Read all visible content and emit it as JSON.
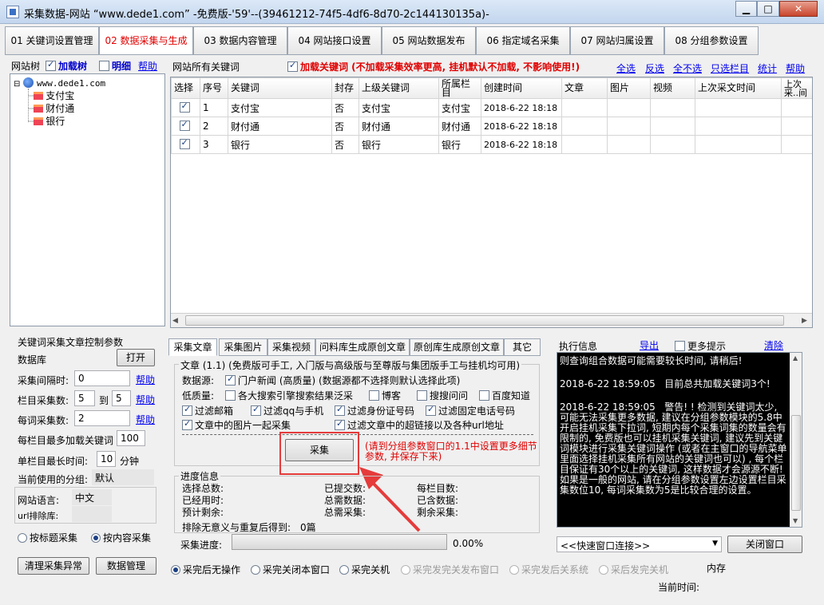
{
  "window": {
    "title": "采集数据-网站 “www.dede1.com” -免费版-'59'--(39461212-74f5-4df6-8d70-2c144130135a)-",
    "min_symbol": "▁",
    "max_symbol": "□",
    "close_symbol": "✕"
  },
  "tabs": [
    {
      "label": "01 关键词设置管理"
    },
    {
      "label": "02 数据采集与生成"
    },
    {
      "label": "03 数据内容管理"
    },
    {
      "label": "04 网站接口设置"
    },
    {
      "label": "05 网站数据发布"
    },
    {
      "label": "06 指定域名采集"
    },
    {
      "label": "07 网站归属设置"
    },
    {
      "label": "08 分组参数设置"
    }
  ],
  "tree_header": {
    "title": "网站树",
    "load_tree": "加载树",
    "detail": "明细",
    "help": "帮助"
  },
  "tree": {
    "root": "www.dede1.com",
    "children": [
      "支付宝",
      "财付通",
      "银行"
    ]
  },
  "kw_header": {
    "title": "网站所有关键词",
    "load_kw": "加载关键词 (不加载采集效率更高, 挂机默认不加载, 不影响使用!)",
    "links": [
      "全选",
      "反选",
      "全不选",
      "只选栏目",
      "统计",
      "帮助"
    ]
  },
  "table": {
    "columns": [
      "选择",
      "序号",
      "关键词",
      "封存",
      "上级关键词",
      "所属栏目",
      "创建时间",
      "文章",
      "图片",
      "视频",
      "上次采文时间",
      "上次采..间"
    ],
    "rows": [
      {
        "no": "1",
        "kw": "支付宝",
        "sealed": "否",
        "parent": "支付宝",
        "column": "支付宝",
        "time": "2018-6-22  18:18"
      },
      {
        "no": "2",
        "kw": "财付通",
        "sealed": "否",
        "parent": "财付通",
        "column": "财付通",
        "time": "2018-6-22  18:18"
      },
      {
        "no": "3",
        "kw": "银行",
        "sealed": "否",
        "parent": "银行",
        "column": "银行",
        "time": "2018-6-22  18:18"
      }
    ]
  },
  "params": {
    "title": "关键词采集文章控制参数",
    "db_label": "数据库",
    "open_btn": "打开",
    "interval_label": "采集间隔时:",
    "interval_val": "0",
    "col_count_label": "栏目采集数:",
    "col_from": "5",
    "to_label": "到",
    "col_to": "5",
    "kw_count_label": "每词采集数:",
    "kw_count": "2",
    "help": "帮助",
    "max_kw_label": "每栏目最多加载关键词",
    "max_kw": "100",
    "max_time_label": "单栏目最长时间:",
    "max_time": "10",
    "minute": "分钟",
    "group_label": "当前使用的分组:",
    "group_val": "默认",
    "lang_label": "网站语言:",
    "lang_val": "中文",
    "url_label": "url排除库:",
    "by_title": "按标题采集",
    "by_content": "按内容采集",
    "clear_btn": "清理采集异常",
    "data_btn": "数据管理"
  },
  "subtabs": [
    "采集文章",
    "采集图片",
    "采集视频",
    "问料库生成原创文章",
    "原创库生成原创文章",
    "其它"
  ],
  "article": {
    "legend": "文章 (1.1) (免费版可手工, 入门版与高级版与至尊版与集团版手工与挂机均可用)",
    "source_label": "数据源:",
    "source_opt": "门户新闻 (高质量) (数据源都不选择则默认选择此项)",
    "lowq_label": "低质量:",
    "lowq_opts": [
      "各大搜索引擎搜索结果泛采",
      "博客",
      "搜搜问问",
      "百度知道"
    ],
    "filters": [
      "过滤邮箱",
      "过滤qq与手机",
      "过滤身份证号码",
      "过滤固定电话号码"
    ],
    "img_opt": "文章中的图片一起采集",
    "url_opt": "过滤文章中的超链接以及各种url地址",
    "collect_btn": "采集",
    "note": "(请到分组参数窗口的1.1中设置更多细节参数, 并保存下来)"
  },
  "progress": {
    "legend": "进度信息",
    "labels": [
      "选择总数:",
      "已提交数:",
      "每栏目数:",
      "已经用时:",
      "总需数据:",
      "已含数据:",
      "预计剩余:",
      "总需采集:",
      "剩余采集:"
    ],
    "dedupe_label": "排除无意义与重复后得到:",
    "dedupe_val": "0篇",
    "bar_label": "采集进度:",
    "percent": "0.00%",
    "fraction": 0
  },
  "exec": {
    "title": "执行信息",
    "export": "导出",
    "more_tips": "更多提示",
    "clear": "清除",
    "log": [
      "则查询组合数据可能需要较长时间, 请稍后!",
      "2018-6-22 18:59:05   目前总共加载关键词3个!",
      "2018-6-22 18:59:05   警告! ! 检测到关键词太少, 可能无法采集更多数据, 建议在分组参数模块的5.8中开启挂机采集下拉词, 短期内每个采集词集的数量会有限制的, 免费版也可以挂机采集关键词, 建议先到关键词模块进行采集关键词操作 (或者在主窗口的导航菜单里面选择挂机采集所有网站的关键词也可以) , 每个栏目保证有30个以上的关键词, 这样数据才会源源不断! 如果是一般的网站, 请在分组参数设置左边设置栏目采集数位10, 每词采集数为5是比较合理的设置。"
    ],
    "quick_select": "<<快速窗口连接>>",
    "close_btn": "关闭窗口"
  },
  "after_opts": [
    "采完后无操作",
    "采完关闭本窗口",
    "采完关机",
    "采完发完关发布窗口",
    "采完发后关系统",
    "采后发完关机"
  ],
  "status": {
    "memory": "内存",
    "current_time": "当前时间:"
  }
}
